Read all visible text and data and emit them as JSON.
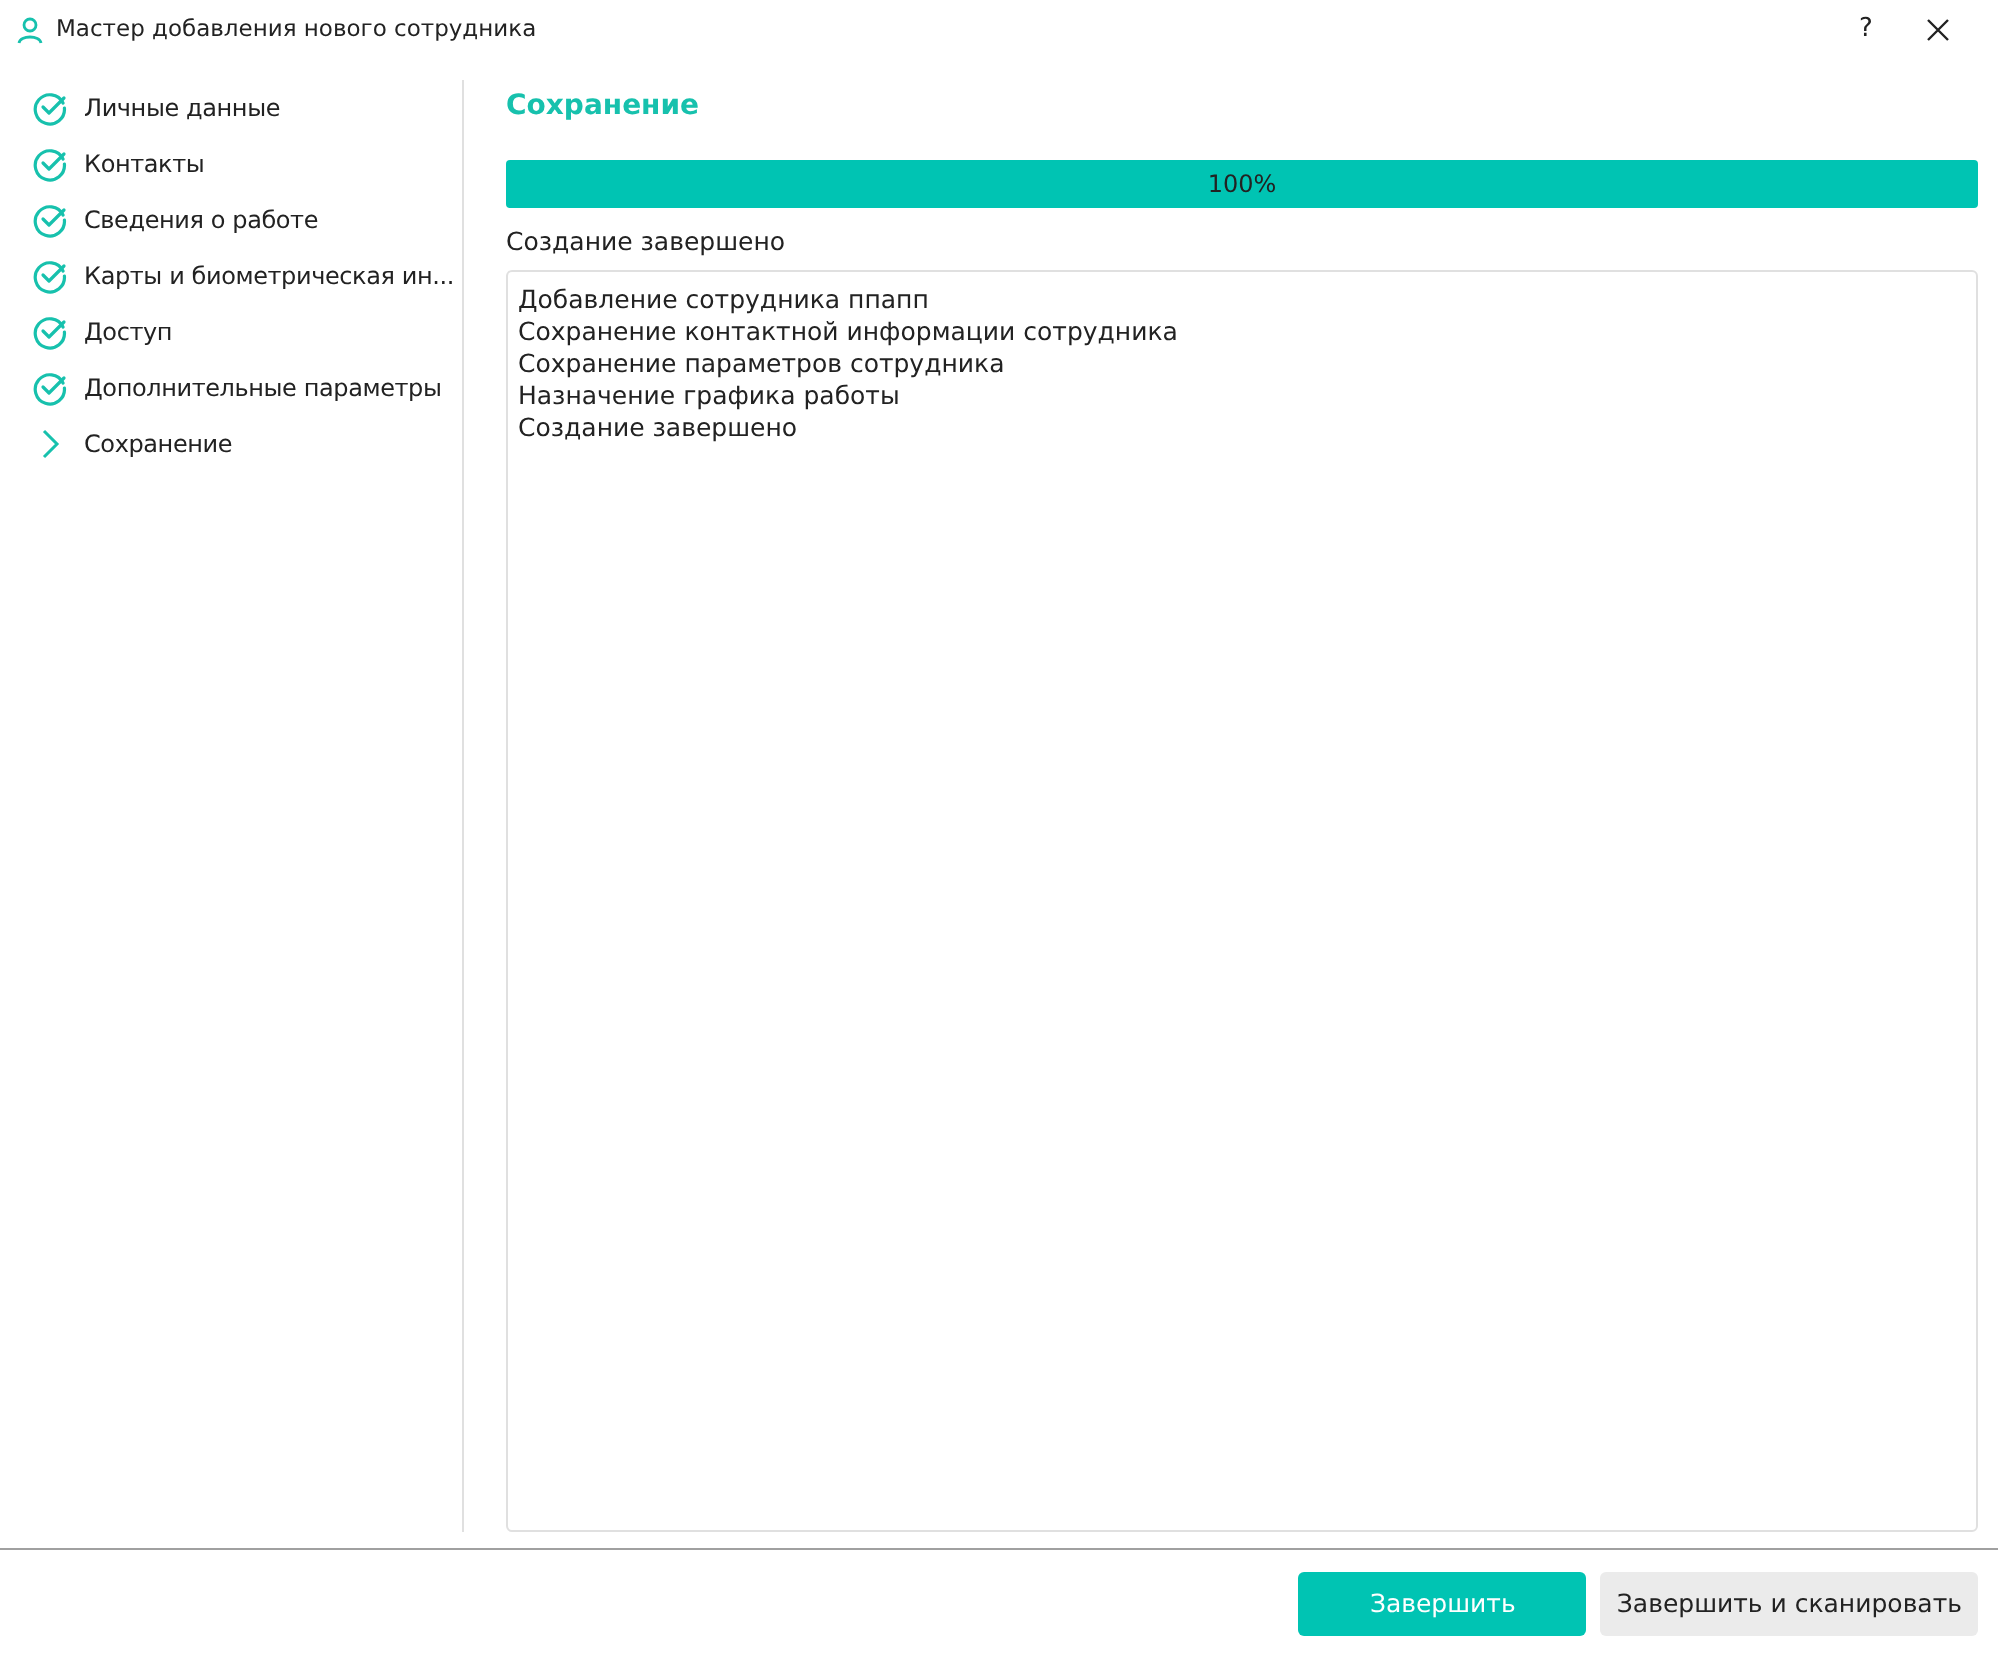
{
  "window": {
    "title": "Мастер добавления нового сотрудника",
    "help": "?"
  },
  "steps": [
    {
      "label": "Личные данные",
      "kind": "done"
    },
    {
      "label": "Контакты",
      "kind": "done"
    },
    {
      "label": "Сведения о работе",
      "kind": "done"
    },
    {
      "label": "Карты и биометрическая ин...",
      "kind": "done"
    },
    {
      "label": "Доступ",
      "kind": "done"
    },
    {
      "label": "Дополнительные параметры",
      "kind": "done"
    },
    {
      "label": "Сохранение",
      "kind": "current"
    }
  ],
  "section_title": "Сохранение",
  "progress": {
    "level": 1,
    "reading": "100%"
  },
  "status": "Создание завершено",
  "log": [
    "Добавление сотрудника ппапп",
    "Сохранение контактной информации сотрудника",
    "Сохранение параметров сотрудника",
    "Назначение графика работы",
    "Создание завершено"
  ],
  "buttons": [
    {
      "label": "Завершить",
      "kind": "primary"
    },
    {
      "label": "Завершить и сканировать",
      "kind": "secondary"
    }
  ]
}
